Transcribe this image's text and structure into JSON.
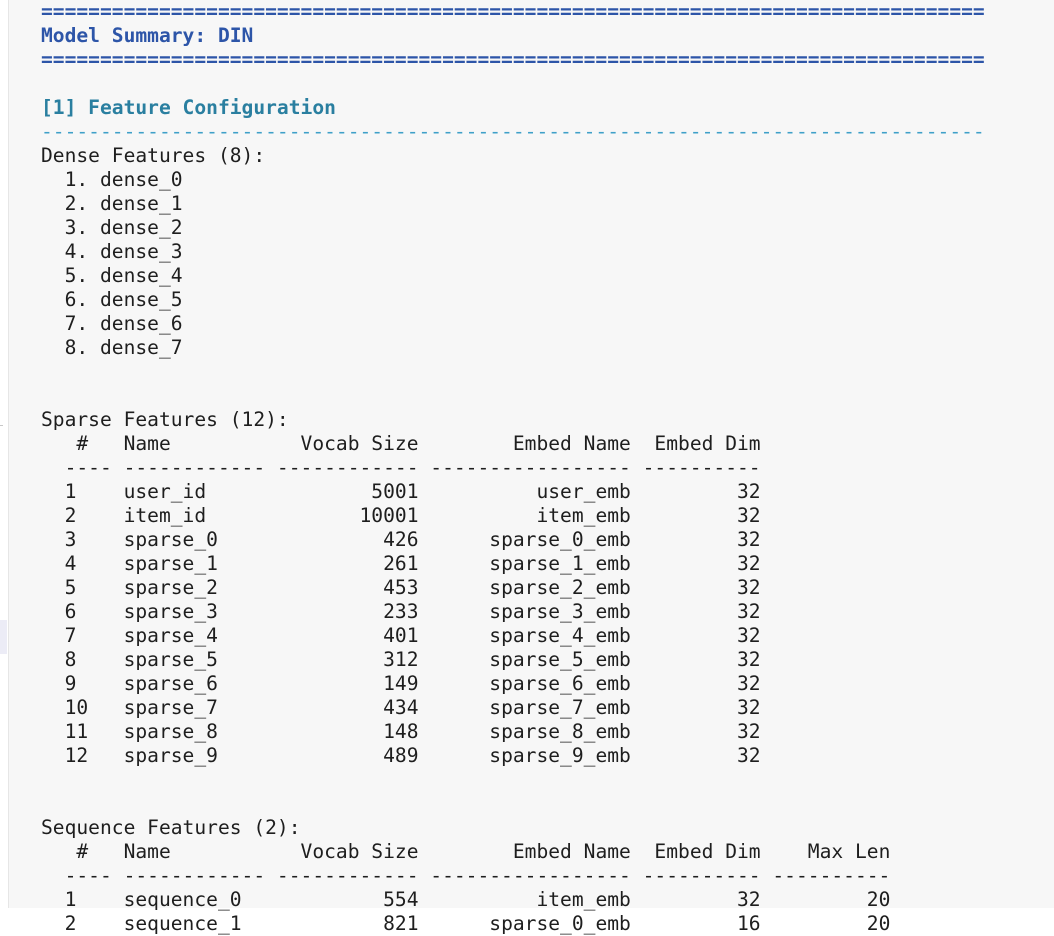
{
  "rules": {
    "major": "================================================================================",
    "minor": "--------------------------------------------------------------------------------"
  },
  "title": "Model Summary: DIN",
  "section_1": "[1] Feature Configuration",
  "dense": {
    "header": "Dense Features (8):",
    "items": [
      "dense_0",
      "dense_1",
      "dense_2",
      "dense_3",
      "dense_4",
      "dense_5",
      "dense_6",
      "dense_7"
    ]
  },
  "sparse": {
    "header": "Sparse Features (12):",
    "columns": [
      "#",
      "Name",
      "Vocab Size",
      "Embed Name",
      "Embed Dim"
    ],
    "rows": [
      [
        "1",
        "user_id",
        "5001",
        "user_emb",
        "32"
      ],
      [
        "2",
        "item_id",
        "10001",
        "item_emb",
        "32"
      ],
      [
        "3",
        "sparse_0",
        "426",
        "sparse_0_emb",
        "32"
      ],
      [
        "4",
        "sparse_1",
        "261",
        "sparse_1_emb",
        "32"
      ],
      [
        "5",
        "sparse_2",
        "453",
        "sparse_2_emb",
        "32"
      ],
      [
        "6",
        "sparse_3",
        "233",
        "sparse_3_emb",
        "32"
      ],
      [
        "7",
        "sparse_4",
        "401",
        "sparse_4_emb",
        "32"
      ],
      [
        "8",
        "sparse_5",
        "312",
        "sparse_5_emb",
        "32"
      ],
      [
        "9",
        "sparse_6",
        "149",
        "sparse_6_emb",
        "32"
      ],
      [
        "10",
        "sparse_7",
        "434",
        "sparse_7_emb",
        "32"
      ],
      [
        "11",
        "sparse_8",
        "148",
        "sparse_8_emb",
        "32"
      ],
      [
        "12",
        "sparse_9",
        "489",
        "sparse_9_emb",
        "32"
      ]
    ]
  },
  "sequence": {
    "header": "Sequence Features (2):",
    "columns": [
      "#",
      "Name",
      "Vocab Size",
      "Embed Name",
      "Embed Dim",
      "Max Len"
    ],
    "rows": [
      [
        "1",
        "sequence_0",
        "554",
        "item_emb",
        "32",
        "20"
      ],
      [
        "2",
        "sequence_1",
        "821",
        "sparse_0_emb",
        "16",
        "20"
      ]
    ]
  },
  "colors": {
    "title": "#2d55a8",
    "section": "#2a7fa0",
    "minor_rule": "#3fa0c8",
    "text": "#1e1e1e",
    "background": "#f7f7f7"
  }
}
